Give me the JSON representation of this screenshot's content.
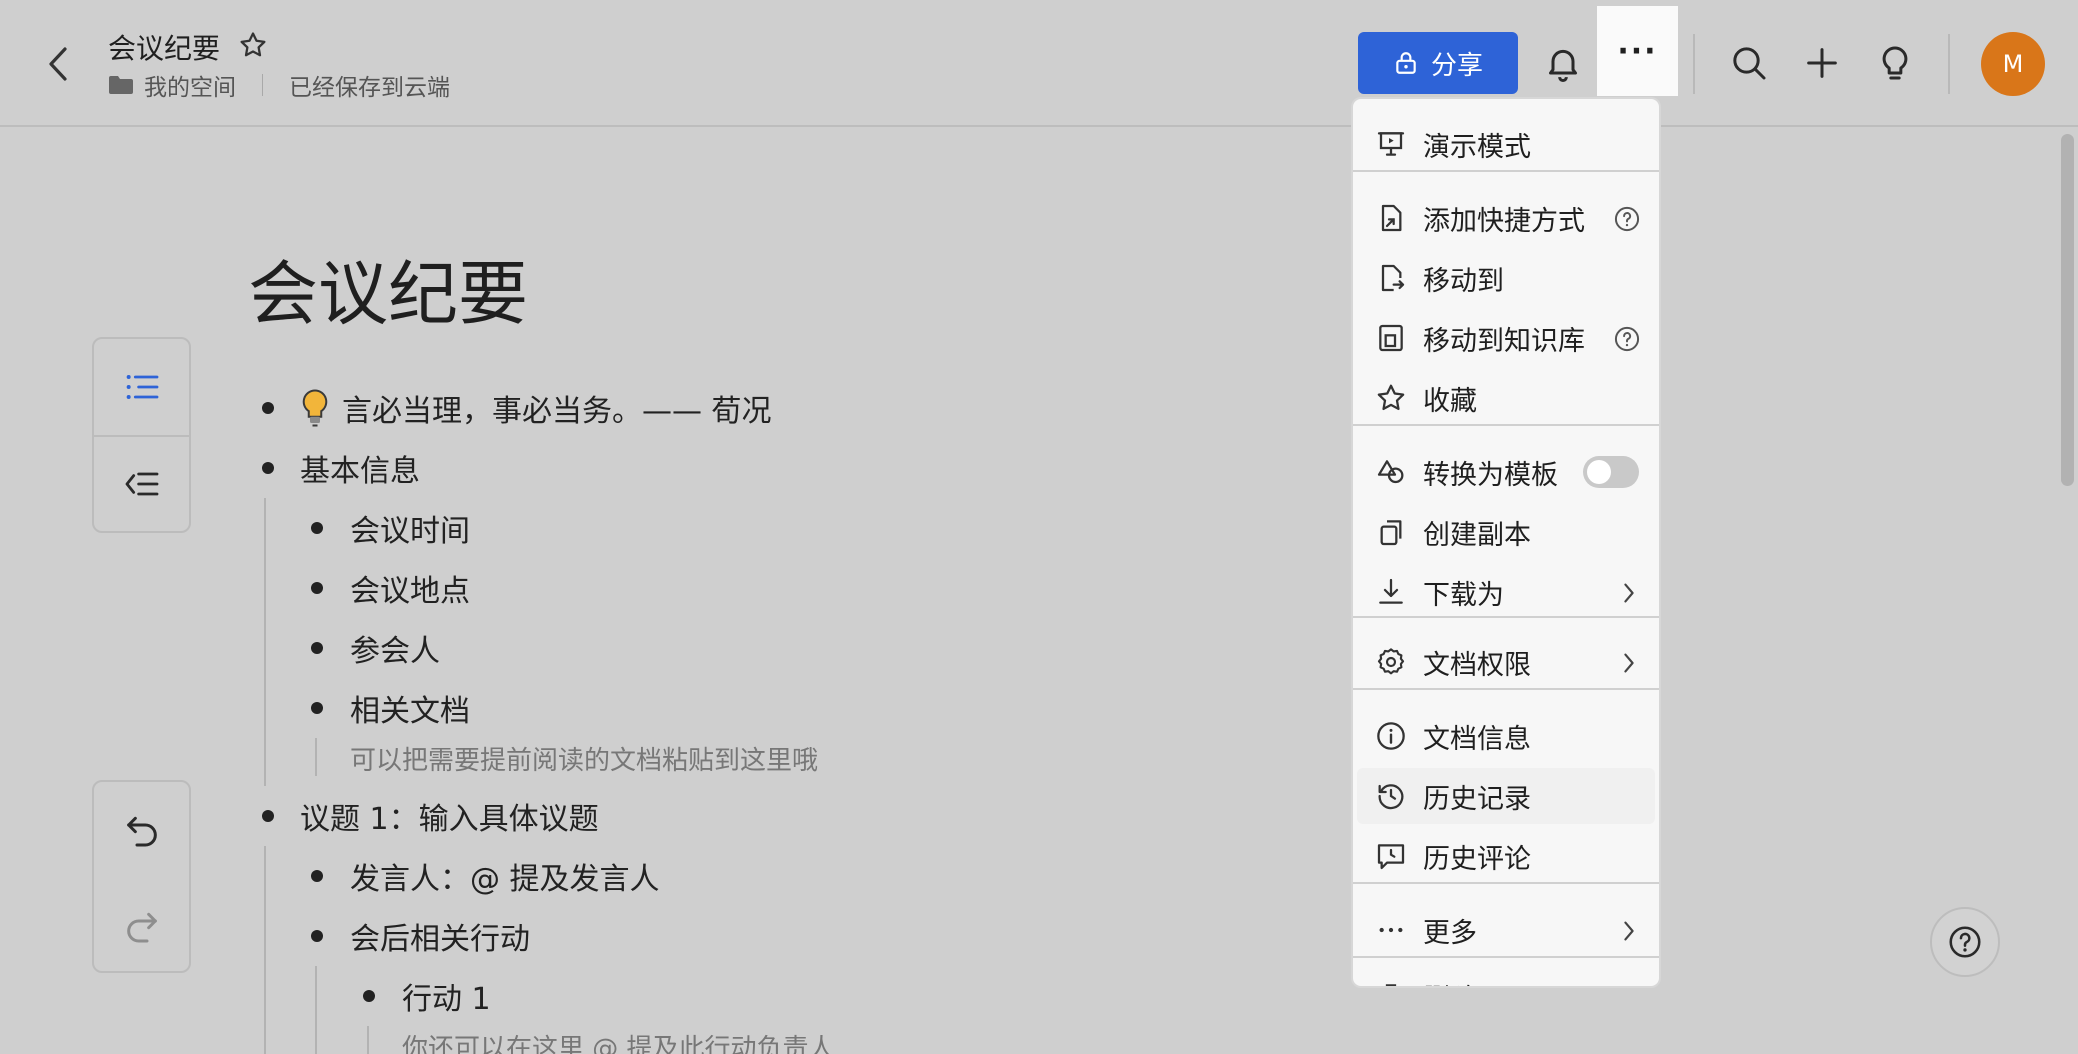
{
  "header": {
    "doc_title": "会议纪要",
    "breadcrumb_space": "我的空间",
    "save_status": "已经保存到云端",
    "share_label": "分享",
    "more_label": "···",
    "avatar_initial": "M"
  },
  "icons": {
    "back": "chevron-left-icon",
    "star": "star-icon",
    "folder": "folder-icon",
    "lock": "lock-icon",
    "bell": "bell-icon",
    "search": "search-icon",
    "plus": "plus-icon",
    "idea": "lightbulb-icon",
    "outline": "list-icon",
    "collapse": "outline-collapse-icon",
    "undo": "undo-icon",
    "redo": "redo-icon",
    "help": "help-icon"
  },
  "colors": {
    "accent": "#2e63d7",
    "avatar": "#d97619"
  },
  "document": {
    "title": "会议纪要",
    "quote": "言必当理，事必当务。—— 荀况",
    "section_basic": "基本信息",
    "basic_items": [
      "会议时间",
      "会议地点",
      "参会人",
      "相关文档"
    ],
    "related_hint": "可以把需要提前阅读的文档粘贴到这里哦",
    "topic1": "议题 1：输入具体议题",
    "speaker": "发言人：@ 提及发言人",
    "actions": "会后相关行动",
    "action1": "行动 1",
    "action1_hint": "你还可以在这里 @ 提及此行动负责人"
  },
  "menu": {
    "items": [
      {
        "label": "演示模式",
        "icon": "presentation-icon"
      },
      {
        "label": "添加快捷方式",
        "icon": "shortcut-icon",
        "help": true
      },
      {
        "label": "移动到",
        "icon": "move-file-icon"
      },
      {
        "label": "移动到知识库",
        "icon": "knowledge-base-icon",
        "help": true
      },
      {
        "label": "收藏",
        "icon": "star-icon"
      },
      {
        "label": "转换为模板",
        "icon": "template-icon",
        "toggle": false
      },
      {
        "label": "创建副本",
        "icon": "copy-icon"
      },
      {
        "label": "下载为",
        "icon": "download-icon",
        "submenu": true
      },
      {
        "label": "文档权限",
        "icon": "settings-icon",
        "submenu": true
      },
      {
        "label": "文档信息",
        "icon": "info-icon"
      },
      {
        "label": "历史记录",
        "icon": "history-icon",
        "active": true
      },
      {
        "label": "历史评论",
        "icon": "comment-history-icon"
      },
      {
        "label": "更多",
        "icon": "more-icon",
        "submenu": true
      },
      {
        "label": "删除",
        "icon": "trash-icon"
      }
    ]
  }
}
